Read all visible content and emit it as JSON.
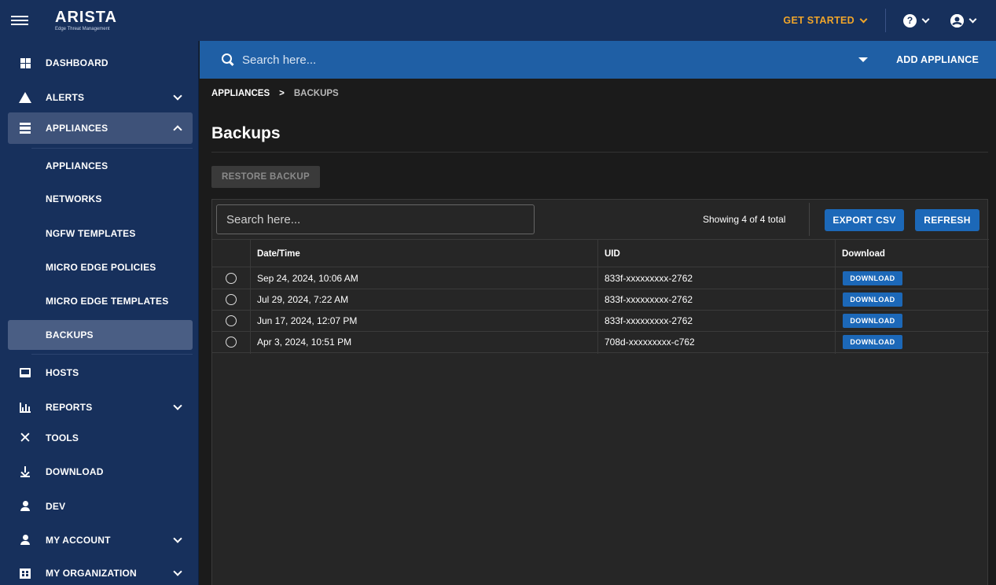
{
  "topbar": {
    "logo_main": "ARISTA",
    "logo_sub": "Edge Threat Management",
    "get_started": "GET STARTED",
    "help_icon": "?",
    "account_icon": "user-circle-icon"
  },
  "sidebar": {
    "items": [
      {
        "label": "DASHBOARD",
        "icon": "dashboard-grid-icon"
      },
      {
        "label": "ALERTS",
        "icon": "warning-triangle-icon"
      },
      {
        "label": "APPLIANCES",
        "icon": "server-icon"
      },
      {
        "label": "HOSTS",
        "icon": "laptop-icon"
      },
      {
        "label": "REPORTS",
        "icon": "bar-chart-icon"
      },
      {
        "label": "TOOLS",
        "icon": "tools-icon"
      },
      {
        "label": "DOWNLOAD",
        "icon": "download-icon"
      },
      {
        "label": "DEV",
        "icon": "person-icon"
      },
      {
        "label": "MY ACCOUNT",
        "icon": "account-settings-icon"
      },
      {
        "label": "MY ORGANIZATION",
        "icon": "building-icon"
      }
    ],
    "appliance_subitems": [
      {
        "label": "APPLIANCES"
      },
      {
        "label": "NETWORKS"
      },
      {
        "label": "NGFW TEMPLATES"
      },
      {
        "label": "MICRO EDGE POLICIES"
      },
      {
        "label": "MICRO EDGE TEMPLATES"
      },
      {
        "label": "BACKUPS",
        "selected": true
      }
    ]
  },
  "searchbar": {
    "placeholder": "Search here...",
    "add_appliance": "ADD APPLIANCE"
  },
  "breadcrumb": {
    "parent": "APPLIANCES",
    "separator": ">",
    "current": "BACKUPS"
  },
  "page": {
    "title": "Backups",
    "restore_label": "RESTORE BACKUP"
  },
  "table": {
    "search_placeholder": "Search here...",
    "showing": "Showing 4 of 4 total",
    "export_label": "EXPORT CSV",
    "refresh_label": "REFRESH",
    "columns": [
      "Date/Time",
      "UID",
      "Download"
    ],
    "rows": [
      {
        "datetime": "Sep 24, 2024, 10:06 AM",
        "uid": "833f-xxxxxxxxx-2762",
        "download": "DOWNLOAD"
      },
      {
        "datetime": "Jul 29, 2024, 7:22 AM",
        "uid": "833f-xxxxxxxxx-2762",
        "download": "DOWNLOAD"
      },
      {
        "datetime": "Jun 17, 2024, 12:07 PM",
        "uid": "833f-xxxxxxxxx-2762",
        "download": "DOWNLOAD"
      },
      {
        "datetime": "Apr 3, 2024, 10:51 PM",
        "uid": "708d-xxxxxxxxx-c762",
        "download": "DOWNLOAD"
      }
    ]
  },
  "colors": {
    "topbar": "#17305c",
    "searchbar": "#1f5fa5",
    "accent_orange": "#f0a52a",
    "button_blue": "#1c68b8",
    "content_bg": "#1b1b1b"
  }
}
